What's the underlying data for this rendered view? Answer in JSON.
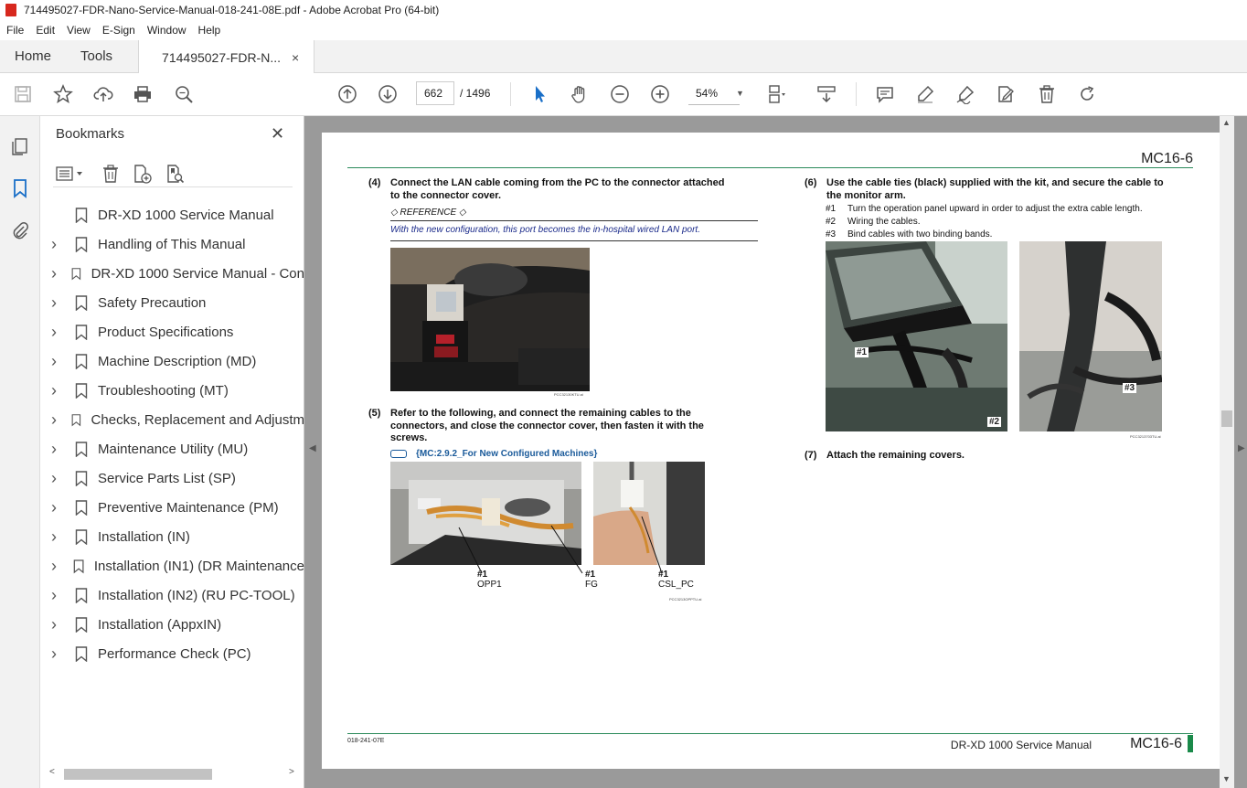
{
  "window": {
    "title": "714495027-FDR-Nano-Service-Manual-018-241-08E.pdf - Adobe Acrobat Pro (64-bit)"
  },
  "menu": [
    "File",
    "Edit",
    "View",
    "E-Sign",
    "Window",
    "Help"
  ],
  "tabs": {
    "home": "Home",
    "tools": "Tools",
    "doc": "714495027-FDR-N...",
    "close": "×"
  },
  "toolbar": {
    "current_page": "662",
    "page_total": "/  1496",
    "zoom": "54%"
  },
  "bookmarks": {
    "title": "Bookmarks",
    "close": "✕",
    "items": [
      {
        "label": "DR-XD 1000 Service Manual",
        "expandable": false
      },
      {
        "label": "Handling of This Manual",
        "expandable": true
      },
      {
        "label": "DR-XD 1000 Service Manual - Con",
        "expandable": true
      },
      {
        "label": "Safety Precaution",
        "expandable": true
      },
      {
        "label": "Product Specifications",
        "expandable": true
      },
      {
        "label": "Machine Description (MD)",
        "expandable": true
      },
      {
        "label": "Troubleshooting (MT)",
        "expandable": true
      },
      {
        "label": "Checks, Replacement and Adjustm",
        "expandable": true
      },
      {
        "label": "Maintenance Utility (MU)",
        "expandable": true
      },
      {
        "label": "Service Parts List (SP)",
        "expandable": true
      },
      {
        "label": "Preventive Maintenance (PM)",
        "expandable": true
      },
      {
        "label": "Installation (IN)",
        "expandable": true
      },
      {
        "label": "Installation (IN1) (DR Maintenance",
        "expandable": true
      },
      {
        "label": "Installation (IN2) (RU PC-TOOL)",
        "expandable": true
      },
      {
        "label": "Installation (AppxIN)",
        "expandable": true
      },
      {
        "label": "Performance Check (PC)",
        "expandable": true
      }
    ]
  },
  "page": {
    "header_code": "MC16-6",
    "step4": {
      "num": "(4)",
      "text1": "Connect the LAN cable coming from the PC to the connector attached",
      "text2": "to the connector cover."
    },
    "reference_label": "◇ REFERENCE ◇",
    "reference_text": "With the new configuration, this port becomes the in-hospital wired LAN port.",
    "step5": {
      "num": "(5)",
      "text1": "Refer to the following, and connect the remaining cables to the",
      "text2": "connectors, and close the connector cover, then fasten it with the",
      "text3": "screws."
    },
    "link_text": "{MC:2.9.2_For New Configured Machines}",
    "captions": [
      {
        "tag": "#1",
        "name": "OPP1"
      },
      {
        "tag": "#1",
        "name": "FG"
      },
      {
        "tag": "#1",
        "name": "CSL_PC"
      }
    ],
    "step6": {
      "num": "(6)",
      "text1": "Use the cable ties (black) supplied with the kit, and secure the cable to",
      "text2": "the monitor arm."
    },
    "step6_subs": [
      {
        "key": "#1",
        "text": "Turn the operation panel upward in order to adjust the extra cable length."
      },
      {
        "key": "#2",
        "text": "Wiring the cables."
      },
      {
        "key": "#3",
        "text": "Bind cables with two binding bands."
      }
    ],
    "photo_tags": {
      "p1": "#1",
      "p2": "#2",
      "p3": "#3"
    },
    "step7": {
      "num": "(7)",
      "text": "Attach the remaining covers."
    },
    "footer_code": "018-241-07E",
    "footer_title": "DR-XD 1000 Service Manual",
    "footer_page": "MC16-6"
  }
}
